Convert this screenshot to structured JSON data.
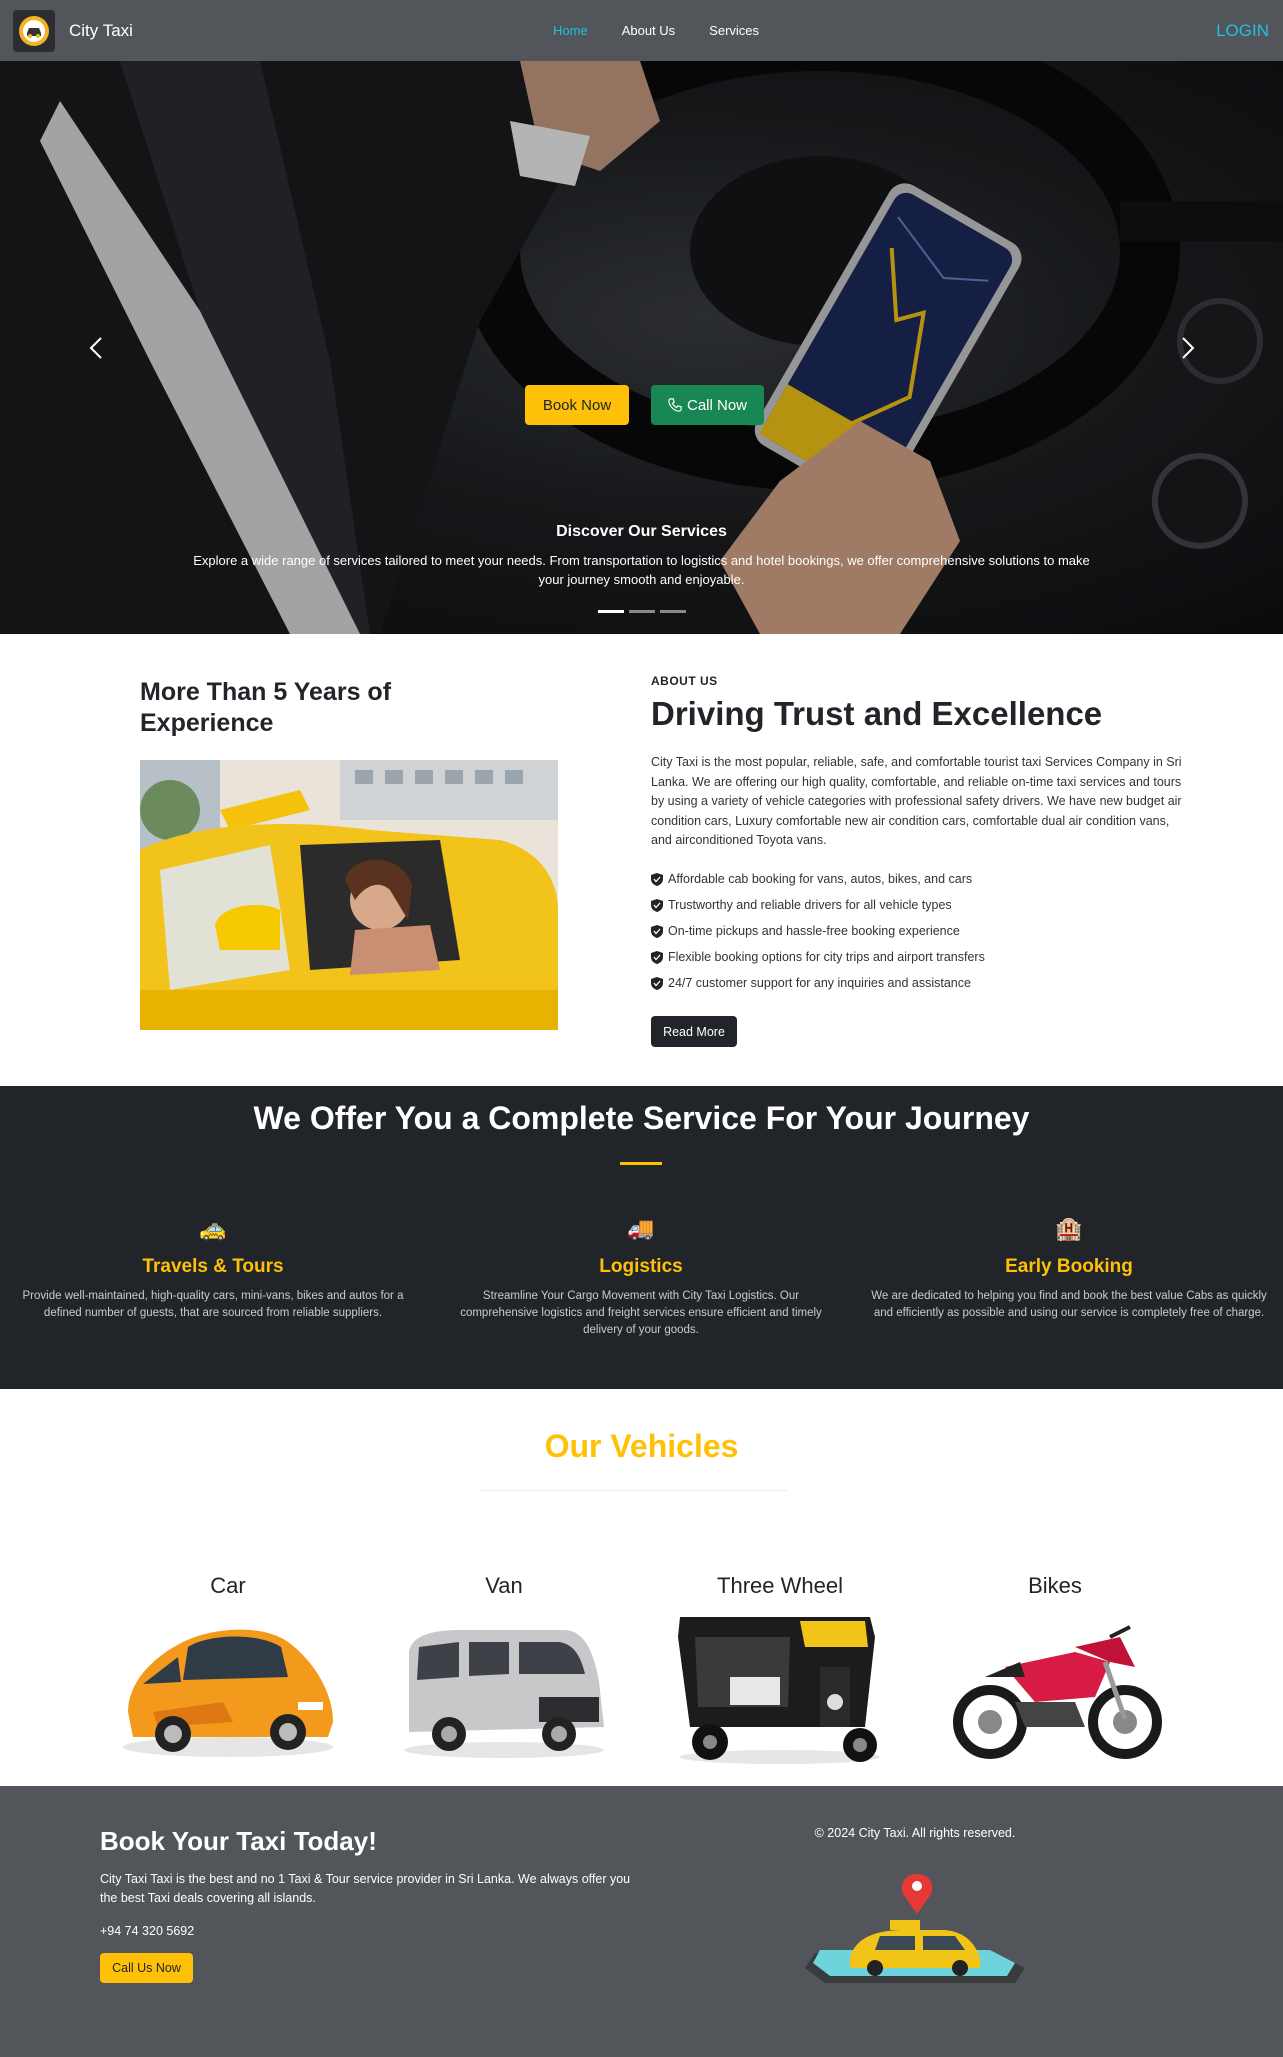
{
  "navbar": {
    "brand": "City Taxi",
    "links": [
      {
        "label": "Home",
        "active": true
      },
      {
        "label": "About Us",
        "active": false
      },
      {
        "label": "Services",
        "active": false
      }
    ],
    "login": "LOGIN"
  },
  "hero": {
    "book_now": "Book Now",
    "call_now": "Call Now",
    "caption_title": "Discover Our Services",
    "caption_text": "Explore a wide range of services tailored to meet your needs. From transportation to logistics and hotel bookings, we offer comprehensive solutions to make your journey smooth and enjoyable.",
    "slides": 3,
    "active_slide": 1
  },
  "about": {
    "left_title": "More Than 5 Years of Experience",
    "eyebrow": "ABOUT US",
    "heading": "Driving Trust and Excellence",
    "text": "City Taxi is the most popular, reliable, safe, and comfortable tourist taxi Services Company in Sri Lanka. We are offering our high quality, comfortable, and reliable on-time taxi services and tours by using a variety of vehicle categories with professional safety drivers. We have new budget air condition cars, Luxury comfortable new air condition cars, comfortable dual air condition vans, and airconditioned Toyota vans.",
    "features": [
      "Affordable cab booking for vans, autos, bikes, and cars",
      "Trustworthy and reliable drivers for all vehicle types",
      "On-time pickups and hassle-free booking experience",
      "Flexible booking options for city trips and airport transfers",
      "24/7 customer support for any inquiries and assistance"
    ],
    "read_more": "Read More"
  },
  "services": {
    "title": "We Offer You a Complete Service For Your Journey",
    "items": [
      {
        "icon": "🚕",
        "title": "Travels & Tours",
        "text": "Provide well-maintained, high-quality cars, mini-vans, bikes and autos for a defined number of guests, that are sourced from reliable suppliers."
      },
      {
        "icon": "🚚",
        "title": "Logistics",
        "text": "Streamline Your Cargo Movement with City Taxi Logistics. Our comprehensive logistics and freight services ensure efficient and timely delivery of your goods."
      },
      {
        "icon": "🏨",
        "title": "Early Booking",
        "text": "We are dedicated to helping you find and book the best value Cabs as quickly and efficiently as possible and using our service is completely free of charge."
      }
    ]
  },
  "vehicles": {
    "title": "Our Vehicles",
    "items": [
      {
        "name": "Car"
      },
      {
        "name": "Van"
      },
      {
        "name": "Three Wheel"
      },
      {
        "name": "Bikes"
      }
    ]
  },
  "footer": {
    "title": "Book Your Taxi Today!",
    "text": "City Taxi Taxi is the best and no 1 Taxi & Tour service provider in Sri Lanka. We always offer you the best Taxi deals covering all islands.",
    "phone": "+94 74 320 5692",
    "call_us": "Call Us Now",
    "copyright": "© 2024 City Taxi. All rights reserved."
  },
  "colors": {
    "navbar": "#52555a",
    "accent_yellow": "#ffc107",
    "accent_cyan": "#22c1dc",
    "success_green": "#198754",
    "dark": "#212529"
  }
}
